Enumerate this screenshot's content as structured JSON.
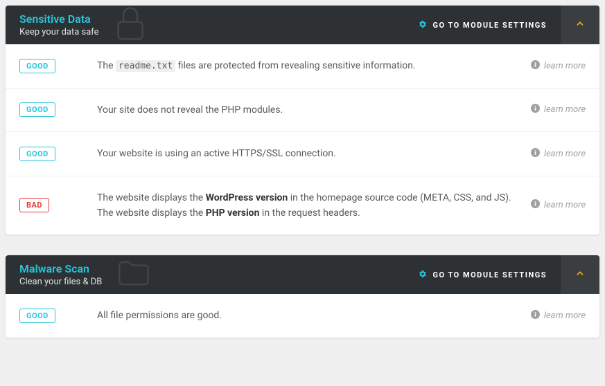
{
  "learn_more_label": "learn more",
  "modules": [
    {
      "title": "Sensitive Data",
      "subtitle": "Keep your data safe",
      "settings_label": "GO TO MODULE SETTINGS",
      "rows": [
        {
          "status": "GOOD",
          "status_class": "good",
          "parts": [
            {
              "t": "text",
              "v": "The "
            },
            {
              "t": "code",
              "v": "readme.txt"
            },
            {
              "t": "text",
              "v": " files are protected from revealing sensitive information."
            }
          ]
        },
        {
          "status": "GOOD",
          "status_class": "good",
          "parts": [
            {
              "t": "text",
              "v": "Your site does not reveal the PHP modules."
            }
          ]
        },
        {
          "status": "GOOD",
          "status_class": "good",
          "parts": [
            {
              "t": "text",
              "v": "Your website is using an active HTTPS/SSL connection."
            }
          ]
        },
        {
          "status": "BAD",
          "status_class": "bad",
          "parts": [
            {
              "t": "text",
              "v": "The website displays the "
            },
            {
              "t": "bold",
              "v": "WordPress version"
            },
            {
              "t": "text",
              "v": " in the homepage source code (META, CSS, and JS)."
            },
            {
              "t": "br"
            },
            {
              "t": "text",
              "v": "The website displays the "
            },
            {
              "t": "bold",
              "v": "PHP version"
            },
            {
              "t": "text",
              "v": " in the request headers."
            }
          ]
        }
      ]
    },
    {
      "title": "Malware Scan",
      "subtitle": "Clean your files & DB",
      "settings_label": "GO TO MODULE SETTINGS",
      "rows": [
        {
          "status": "GOOD",
          "status_class": "good",
          "parts": [
            {
              "t": "text",
              "v": "All file permissions are good."
            }
          ]
        }
      ]
    }
  ]
}
